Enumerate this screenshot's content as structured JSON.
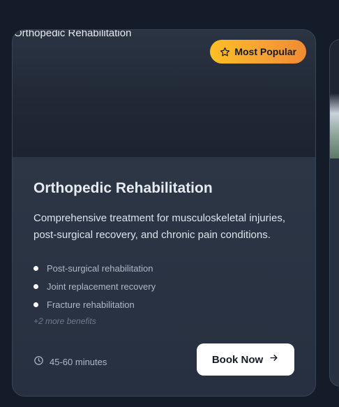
{
  "card": {
    "image_alt": "Orthopedic Rehabilitation",
    "badge": {
      "icon": "star-icon",
      "label": "Most Popular",
      "gradient": [
        "#fbbf24",
        "#f08a34"
      ]
    },
    "title": "Orthopedic Rehabilitation",
    "description": "Comprehensive treatment for musculoskeletal injuries, post-surgical recovery, and chronic pain conditions.",
    "benefits": [
      "Post-surgical rehabilitation",
      "Joint replacement recovery",
      "Fracture rehabilitation"
    ],
    "more_benefits": "+2 more benefits",
    "duration": {
      "icon": "clock-icon",
      "text": "45-60 minutes"
    },
    "cta": {
      "label": "Book Now",
      "icon": "arrow-right-icon"
    }
  },
  "colors": {
    "page_background": "#141b29",
    "card_background": "#273140",
    "title": "#e6ebf3",
    "muted": "#aeb8c8"
  }
}
